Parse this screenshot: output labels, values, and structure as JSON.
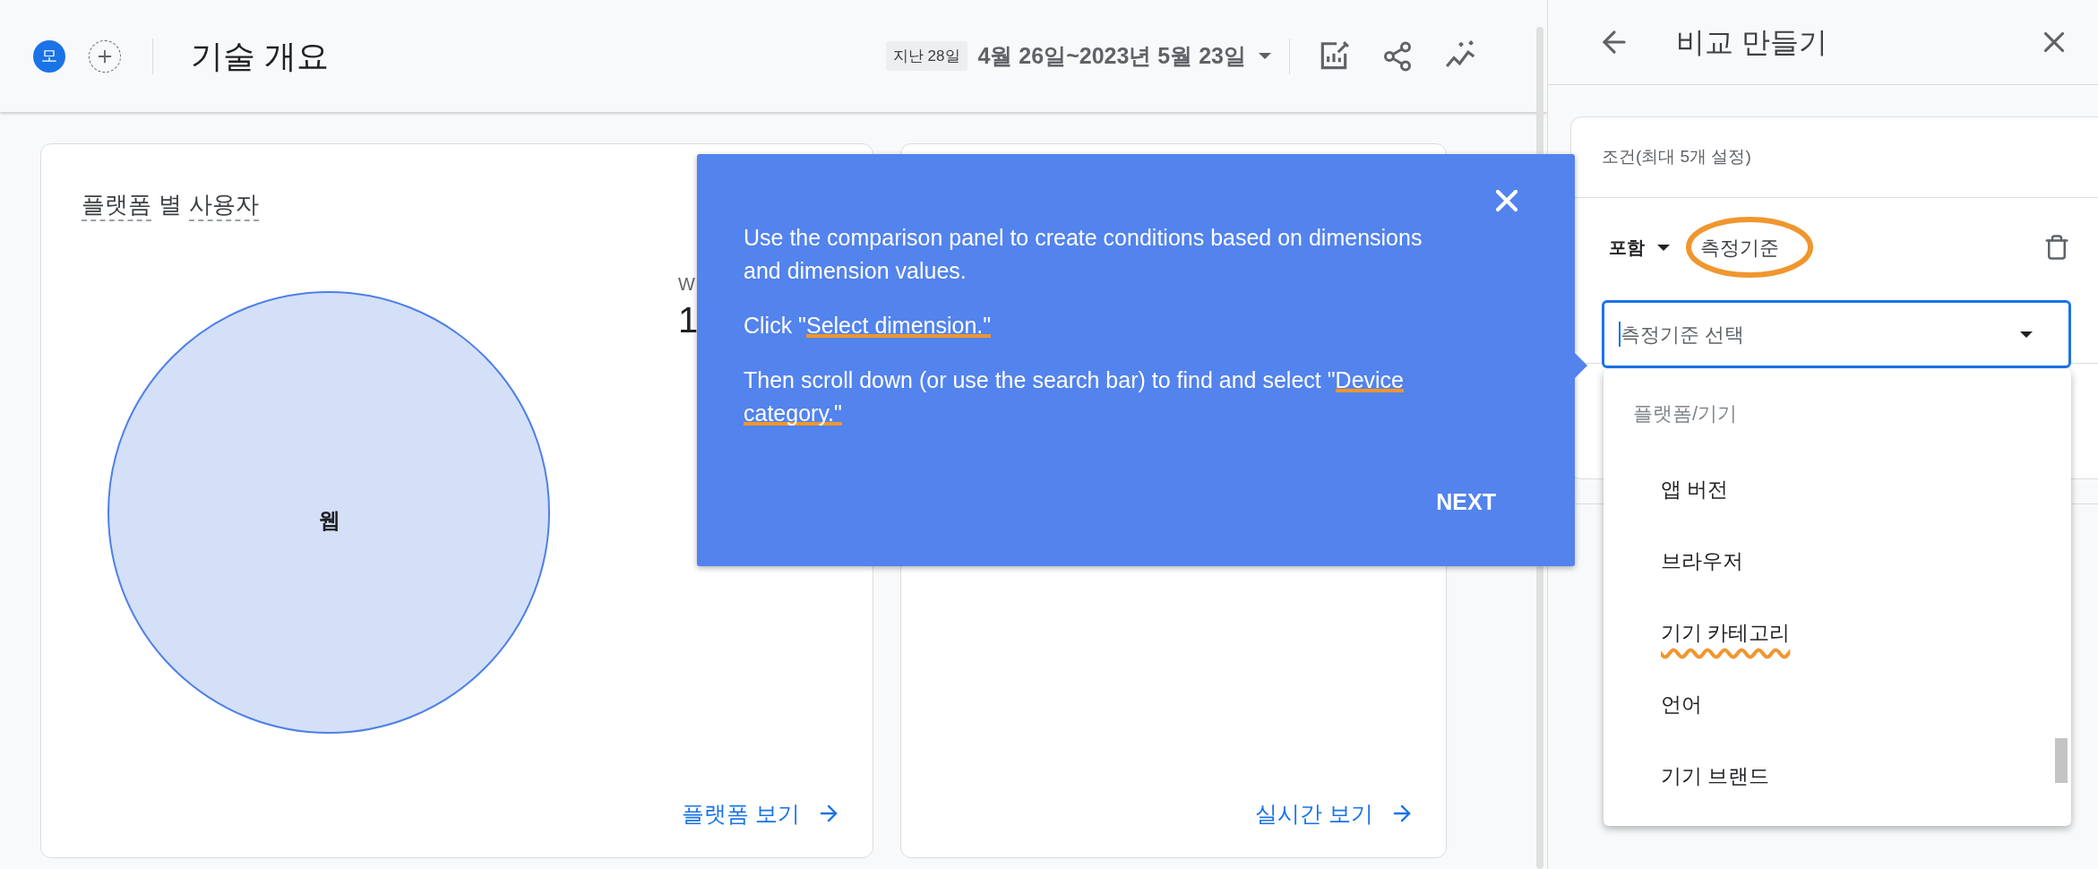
{
  "header": {
    "avatar": "모",
    "title": "기술 개요",
    "date_chip": "지난 28일",
    "date_range": "4월 26일~2023년 5월 23일"
  },
  "cards": [
    {
      "kind": "platform",
      "title": [
        {
          "text": "플랫폼",
          "dotted": true
        },
        {
          "text": "별",
          "dotted": false
        },
        {
          "text": "사용자",
          "dotted": true
        }
      ],
      "slice_label": "웹",
      "legend_label": "W",
      "legend_value": "1",
      "link": "플랫폼 보기"
    },
    {
      "kind": "realtime",
      "link": "실시간 보기"
    }
  ],
  "tooltip": {
    "paragraphs": [
      [
        {
          "text": "Use the comparison panel to create conditions based on dimensions and dimension values.",
          "highlighted": false
        }
      ],
      [
        {
          "text": "Click \"",
          "highlighted": false
        },
        {
          "text": "Select dimension.\"",
          "highlighted": true
        }
      ],
      [
        {
          "text": "Then scroll down (or use the search bar) to find and select \"",
          "highlighted": false
        },
        {
          "text": "Device category.\"",
          "highlighted": true
        }
      ]
    ],
    "button": "NEXT"
  },
  "panel": {
    "title": "비교 만들기",
    "section_label": "조건(최대 5개 설정)",
    "condition": {
      "mode": "포함",
      "dimension_label": "측정기준",
      "circled": true
    },
    "select": {
      "placeholder": "측정기준 선택"
    },
    "menu": {
      "group": "플랫폼/기기",
      "items": [
        {
          "label": "앱 버전",
          "highlighted": false
        },
        {
          "label": "브라우저",
          "highlighted": false
        },
        {
          "label": "기기 카테고리",
          "highlighted": true
        },
        {
          "label": "언어",
          "highlighted": false
        },
        {
          "label": "기기 브랜드",
          "highlighted": false
        }
      ]
    }
  }
}
